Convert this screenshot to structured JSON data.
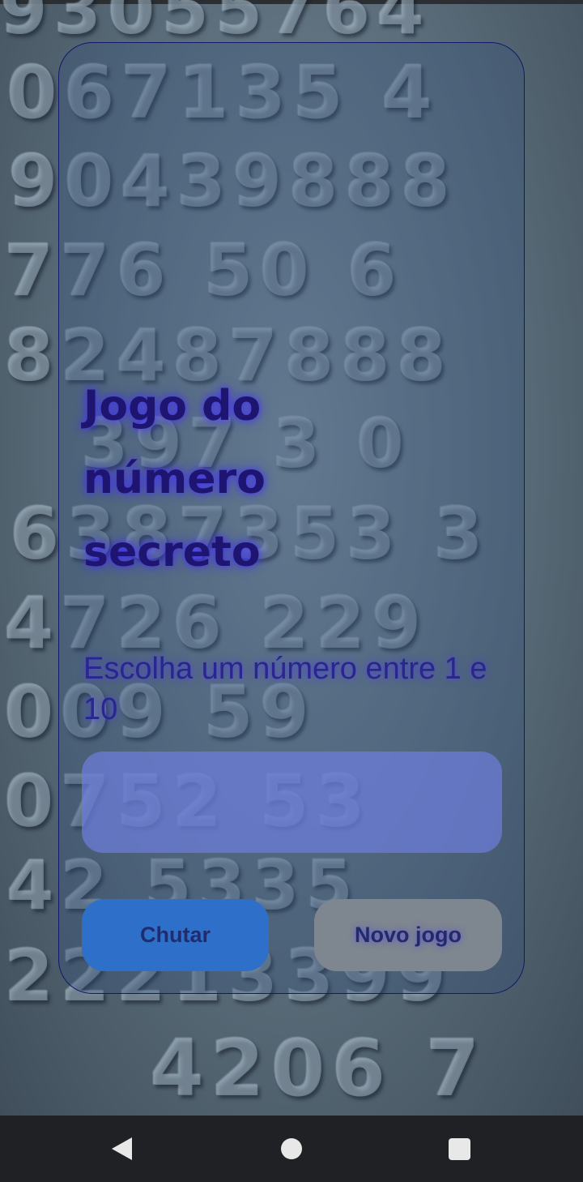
{
  "game": {
    "title": "Jogo do número secreto",
    "instruction": "Escolha um número entre 1 e 10",
    "input": {
      "value": "",
      "placeholder": ""
    },
    "buttons": {
      "guess_label": "Chutar",
      "new_game_label": "Novo jogo"
    }
  },
  "colors": {
    "title": "#1e1570",
    "title_glow": "#3c28ff",
    "card_border": "#12186b",
    "input_fill": "#6e7ddc",
    "guess_button": "#2e6fc9",
    "new_game_button": "#7e8690"
  },
  "navbar": {
    "icons": [
      "back-icon",
      "home-icon",
      "recent-apps-icon"
    ]
  }
}
